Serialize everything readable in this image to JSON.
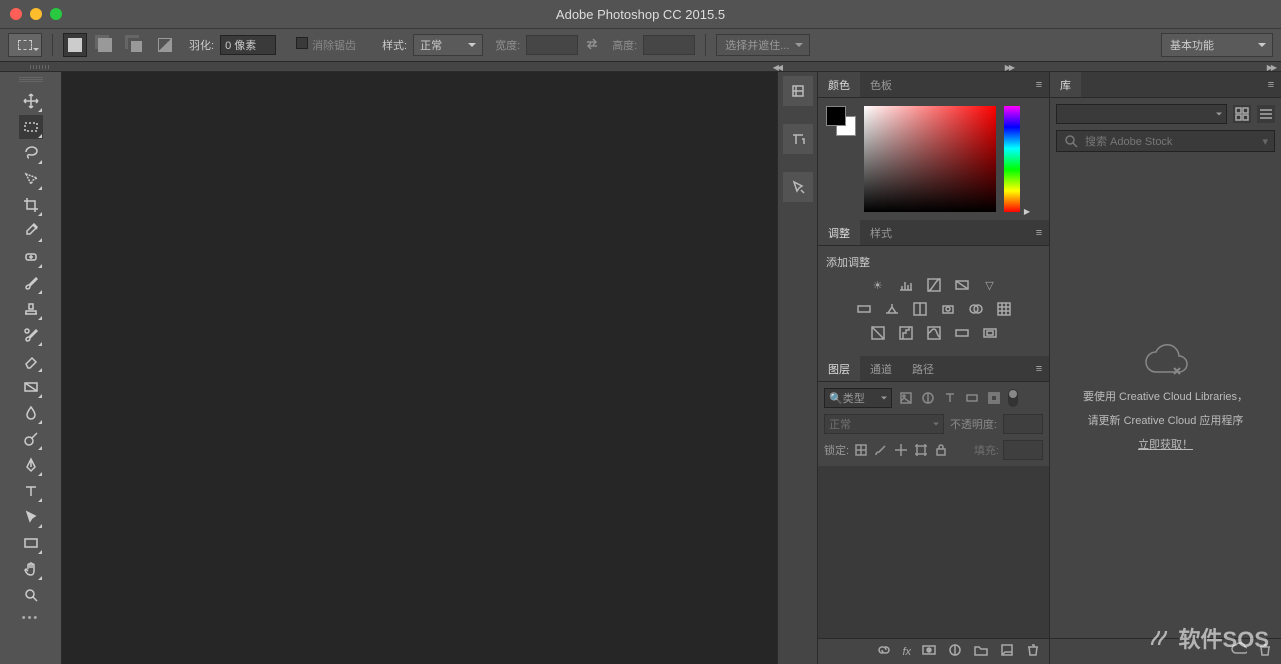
{
  "title": "Adobe Photoshop CC 2015.5",
  "optbar": {
    "feather_label": "羽化:",
    "feather_value": "0 像素",
    "antialias_label": "消除锯齿",
    "style_label": "样式:",
    "style_value": "正常",
    "width_label": "宽度:",
    "height_label": "高度:",
    "mask_label": "选择并遮住...",
    "workspace": "基本功能"
  },
  "panels": {
    "color_tab": "颜色",
    "swatches_tab": "色板",
    "adjustments_tab": "调整",
    "styles_tab": "样式",
    "add_adjustment": "添加调整",
    "layers_tab": "图层",
    "channels_tab": "通道",
    "paths_tab": "路径",
    "filter_kind": "类型",
    "blend_mode": "正常",
    "opacity_label": "不透明度:",
    "lock_label": "锁定:",
    "fill_label": "填充:"
  },
  "libraries": {
    "tab": "库",
    "search_placeholder": "搜索 Adobe Stock",
    "msg1": "要使用 Creative Cloud Libraries，",
    "msg2": "请更新 Creative Cloud 应用程序",
    "link": "立即获取！"
  },
  "watermark": "软件SOS"
}
